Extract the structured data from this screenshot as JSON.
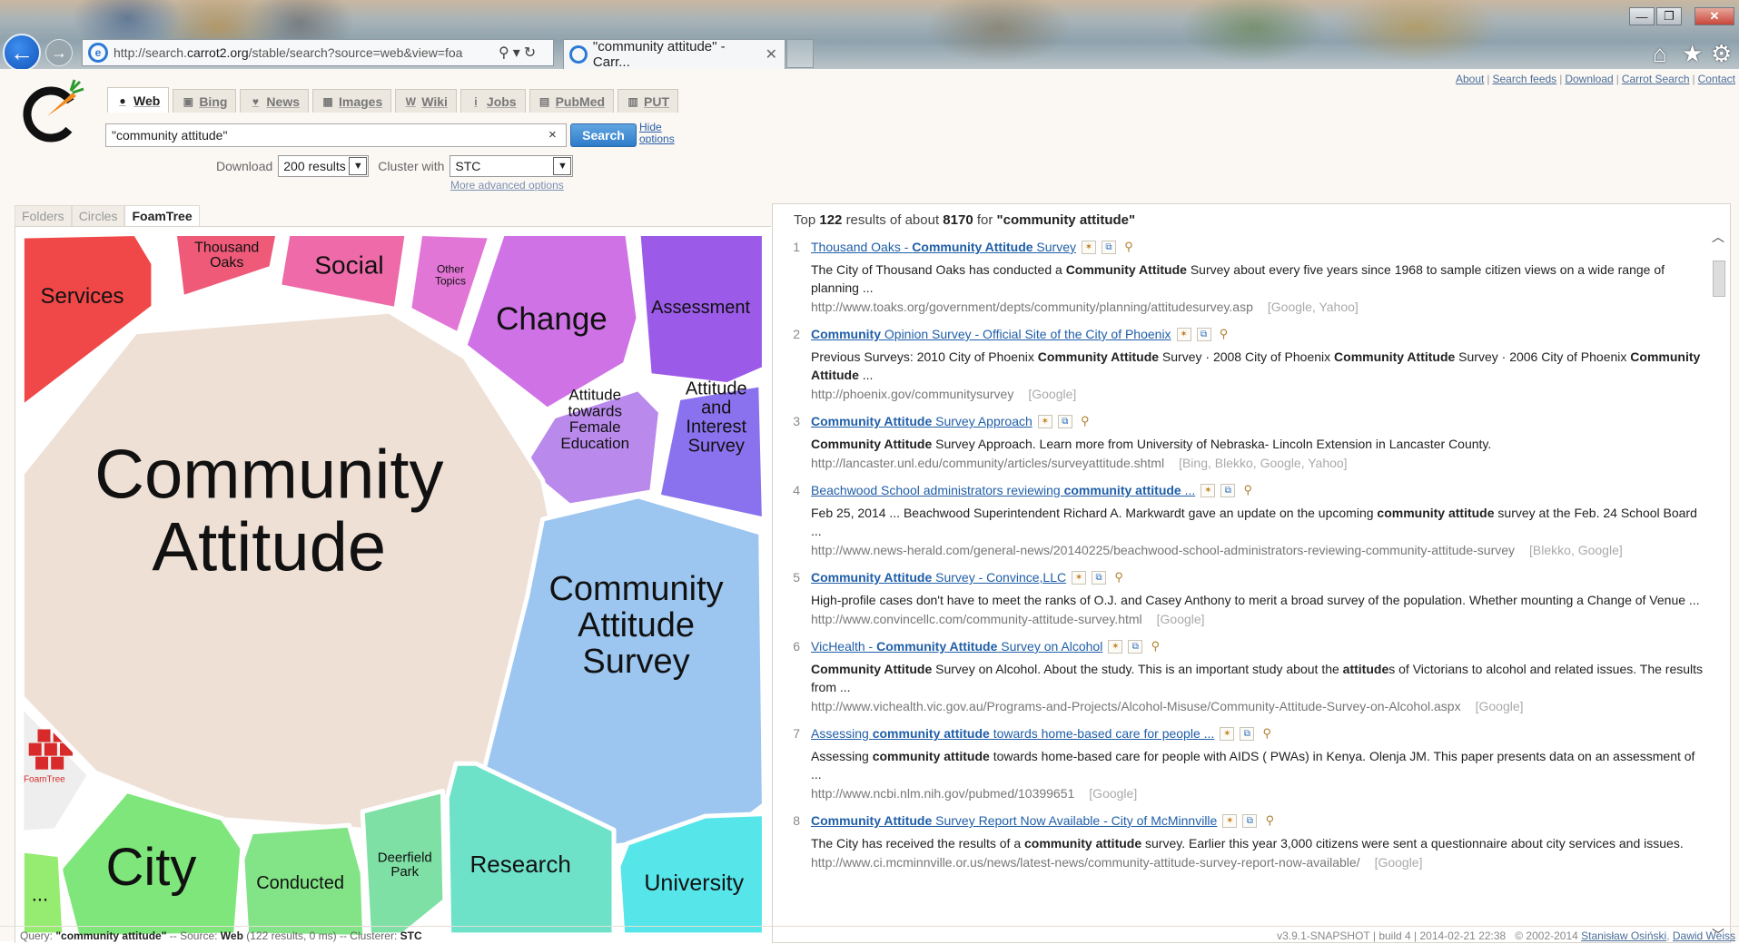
{
  "browser": {
    "url": "http://search.carrot2.org/stable/search?source=web&view=foa",
    "url_prefix": "http://search.",
    "url_domain": "carrot2.org",
    "url_suffix": "/stable/search?source=web&view=foa",
    "tab_title": "\"community attitude\" - Carr...",
    "window_controls": {
      "minimize": "—",
      "restore": "❐",
      "close": "✕"
    }
  },
  "top_links": [
    "About",
    "Search feeds",
    "Download",
    "Carrot Search",
    "Contact"
  ],
  "source_tabs": [
    {
      "label": "Web",
      "icon": "globe-icon",
      "glyph": "●",
      "active": true
    },
    {
      "label": "Bing",
      "icon": "bing-icon",
      "glyph": "▣",
      "active": false
    },
    {
      "label": "News",
      "icon": "bulb-icon",
      "glyph": "♥",
      "active": false
    },
    {
      "label": "Images",
      "icon": "image-icon",
      "glyph": "▦",
      "active": false
    },
    {
      "label": "Wiki",
      "icon": "wiki-icon",
      "glyph": "W",
      "active": false
    },
    {
      "label": "Jobs",
      "icon": "info-icon",
      "glyph": "i",
      "active": false
    },
    {
      "label": "PubMed",
      "icon": "pubmed-icon",
      "glyph": "▤",
      "active": false
    },
    {
      "label": "PUT",
      "icon": "put-icon",
      "glyph": "▥",
      "active": false
    }
  ],
  "search": {
    "query": "\"community attitude\"",
    "clear": "×",
    "button": "Search",
    "hide_options": "Hide options",
    "download_label": "Download",
    "download_value": "200 results",
    "cluster_label": "Cluster with",
    "cluster_value": "STC",
    "more_advanced": "More advanced options"
  },
  "view_tabs": [
    {
      "label": "Folders",
      "active": false
    },
    {
      "label": "Circles",
      "active": false
    },
    {
      "label": "FoamTree",
      "active": true
    }
  ],
  "foamtree": {
    "brand_label": "FoamTree",
    "clusters": [
      {
        "id": "services",
        "lines": [
          "Services"
        ],
        "color": "#f04848"
      },
      {
        "id": "thousand-oaks",
        "lines": [
          "Thousand",
          "Oaks"
        ],
        "color": "#ee5a78"
      },
      {
        "id": "social",
        "lines": [
          "Social"
        ],
        "color": "#ee6aa8"
      },
      {
        "id": "other-topics",
        "lines": [
          "Other",
          "Topics"
        ],
        "color": "#e276d6"
      },
      {
        "id": "change",
        "lines": [
          "Change"
        ],
        "color": "#cf72e6"
      },
      {
        "id": "assessment",
        "lines": [
          "Assessment"
        ],
        "color": "#9b5ae8"
      },
      {
        "id": "attitude-female-education",
        "lines": [
          "Attitude",
          "towards",
          "Female",
          "Education"
        ],
        "color": "#b98aec"
      },
      {
        "id": "attitude-interest-survey",
        "lines": [
          "Attitude",
          "and",
          "Interest",
          "Survey"
        ],
        "color": "#8a72ee"
      },
      {
        "id": "community-attitude",
        "lines": [
          "Community",
          "Attitude"
        ],
        "color": "#efe0d6"
      },
      {
        "id": "community-attitude-survey",
        "lines": [
          "Community",
          "Attitude",
          "Survey"
        ],
        "color": "#9cc6f0"
      },
      {
        "id": "city",
        "lines": [
          "City"
        ],
        "color": "#7ee67a"
      },
      {
        "id": "conducted",
        "lines": [
          "Conducted"
        ],
        "color": "#82e486"
      },
      {
        "id": "deerfield-park",
        "lines": [
          "Deerfield",
          "Park"
        ],
        "color": "#7ee0a4"
      },
      {
        "id": "research",
        "lines": [
          "Research"
        ],
        "color": "#6ee2c8"
      },
      {
        "id": "university",
        "lines": [
          "University"
        ],
        "color": "#56e6ea"
      },
      {
        "id": "more",
        "lines": [
          "..."
        ],
        "color": "#96ec70"
      }
    ]
  },
  "results": {
    "summary_prefix": "Top",
    "top_count": "122",
    "summary_mid": "results of about",
    "total": "8170",
    "summary_for": "for",
    "query": "\"community attitude\"",
    "items": [
      {
        "num": "1",
        "title_parts": [
          {
            "t": "Thousand Oaks - ",
            "b": false
          },
          {
            "t": "Community Attitude",
            "b": true
          },
          {
            "t": " Survey",
            "b": false
          }
        ],
        "snippet_parts": [
          {
            "t": "The City of Thousand Oaks has conducted a ",
            "b": false
          },
          {
            "t": "Community Attitude",
            "b": true
          },
          {
            "t": " Survey about every five years since 1968 to sample citizen views on a wide range of planning ...",
            "b": false
          }
        ],
        "url": "http://www.toaks.org/government/depts/community/planning/attitudesurvey.asp",
        "sources": "[Google, Yahoo]"
      },
      {
        "num": "2",
        "title_parts": [
          {
            "t": "Community",
            "b": true
          },
          {
            "t": " Opinion Survey - Official Site of the City of Phoenix",
            "b": false
          }
        ],
        "snippet_parts": [
          {
            "t": "Previous Surveys: 2010 City of Phoenix ",
            "b": false
          },
          {
            "t": "Community Attitude",
            "b": true
          },
          {
            "t": " Survey · 2008 City of Phoenix ",
            "b": false
          },
          {
            "t": "Community Attitude",
            "b": true
          },
          {
            "t": " Survey · 2006 City of Phoenix ",
            "b": false
          },
          {
            "t": "Community Attitude",
            "b": true
          },
          {
            "t": " ...",
            "b": false
          }
        ],
        "url": "http://phoenix.gov/communitysurvey",
        "sources": "[Google]"
      },
      {
        "num": "3",
        "title_parts": [
          {
            "t": "Community Attitude",
            "b": true
          },
          {
            "t": " Survey Approach",
            "b": false
          }
        ],
        "snippet_parts": [
          {
            "t": "Community Attitude",
            "b": true
          },
          {
            "t": " Survey Approach. Learn more from University of Nebraska- Lincoln Extension in Lancaster County.",
            "b": false
          }
        ],
        "url": "http://lancaster.unl.edu/community/articles/surveyattitude.shtml",
        "sources": "[Bing, Blekko, Google, Yahoo]"
      },
      {
        "num": "4",
        "title_parts": [
          {
            "t": "Beachwood School administrators reviewing ",
            "b": false
          },
          {
            "t": "community attitude",
            "b": true
          },
          {
            "t": " ...",
            "b": false
          }
        ],
        "snippet_parts": [
          {
            "t": "Feb 25, 2014 ... Beachwood Superintendent Richard A. Markwardt gave an update on the upcoming ",
            "b": false
          },
          {
            "t": "community attitude",
            "b": true
          },
          {
            "t": " survey at the Feb. 24 School Board ...",
            "b": false
          }
        ],
        "url": "http://www.news-herald.com/general-news/20140225/beachwood-school-administrators-reviewing-community-attitude-survey",
        "sources": "[Blekko, Google]"
      },
      {
        "num": "5",
        "title_parts": [
          {
            "t": "Community Attitude",
            "b": true
          },
          {
            "t": " Survey - Convince,LLC",
            "b": false
          }
        ],
        "snippet_parts": [
          {
            "t": "High-profile cases don't have to meet the ranks of O.J. and Casey Anthony to merit a broad survey of the population. Whether mounting a Change of Venue ...",
            "b": false
          }
        ],
        "url": "http://www.convincellc.com/community-attitude-survey.html",
        "sources": "[Google]"
      },
      {
        "num": "6",
        "title_parts": [
          {
            "t": "VicHealth - ",
            "b": false
          },
          {
            "t": "Community Attitude",
            "b": true
          },
          {
            "t": " Survey on Alcohol",
            "b": false
          }
        ],
        "snippet_parts": [
          {
            "t": "Community Attitude",
            "b": true
          },
          {
            "t": " Survey on Alcohol. About the study. This is an important study about the ",
            "b": false
          },
          {
            "t": "attitude",
            "b": true
          },
          {
            "t": "s of Victorians to alcohol and related issues. The results from ...",
            "b": false
          }
        ],
        "url": "http://www.vichealth.vic.gov.au/Programs-and-Projects/Alcohol-Misuse/Community-Attitude-Survey-on-Alcohol.aspx",
        "sources": "[Google]"
      },
      {
        "num": "7",
        "title_parts": [
          {
            "t": "Assessing ",
            "b": false
          },
          {
            "t": "community attitude",
            "b": true
          },
          {
            "t": " towards home-based care for people ...",
            "b": false
          }
        ],
        "snippet_parts": [
          {
            "t": "Assessing ",
            "b": false
          },
          {
            "t": "community attitude",
            "b": true
          },
          {
            "t": " towards home-based care for people with AIDS ( PWAs) in Kenya. Olenja JM. This paper presents data on an assessment of ...",
            "b": false
          }
        ],
        "url": "http://www.ncbi.nlm.nih.gov/pubmed/10399651",
        "sources": "[Google]"
      },
      {
        "num": "8",
        "title_parts": [
          {
            "t": "Community Attitude",
            "b": true
          },
          {
            "t": " Survey Report Now Available - City of McMinnville",
            "b": false
          }
        ],
        "snippet_parts": [
          {
            "t": "The City has received the results of a ",
            "b": false
          },
          {
            "t": "community attitude",
            "b": true
          },
          {
            "t": " survey. Earlier this year 3,000 citizens were sent a questionnaire about city services and issues.",
            "b": false
          }
        ],
        "url": "http://www.ci.mcminnville.or.us/news/latest-news/community-attitude-survey-report-now-available/",
        "sources": "[Google]"
      }
    ]
  },
  "footer": {
    "query_label": "Query:",
    "query": "\"community attitude\"",
    "source_label": "-- Source:",
    "source": "Web",
    "stats": "(122 results, 0 ms) -- Clusterer:",
    "clusterer": "STC",
    "version": "v3.9.1-SNAPSHOT | build 4 | 2014-02-21 22:38",
    "copyright": "© 2002-2014",
    "author1": "Stanisław Osiński",
    "author2": "Dawid Weiss"
  },
  "colors": {
    "accent": "#2e7cc9",
    "link": "#1f5ea8",
    "page_bg": "#fbf8f4"
  }
}
